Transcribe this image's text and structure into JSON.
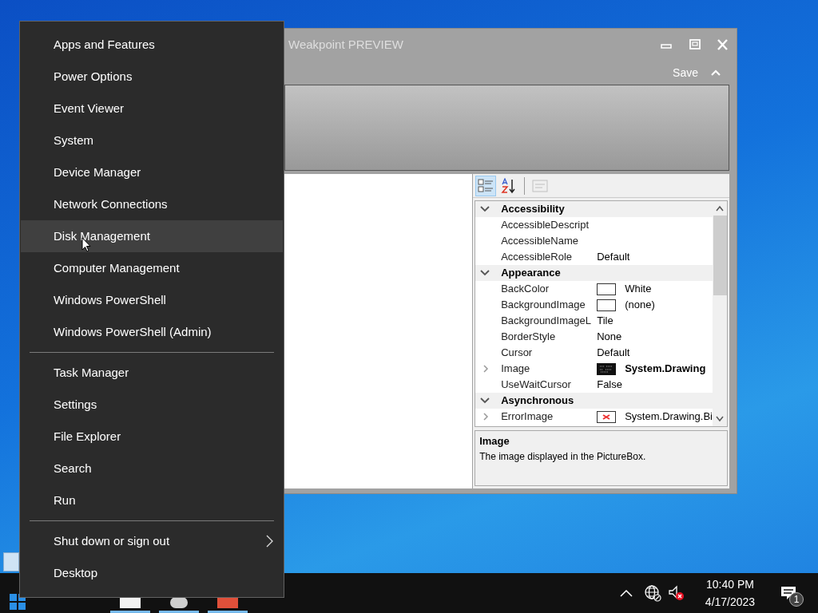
{
  "app_window": {
    "title": "Weakpoint PREVIEW",
    "save_label": "Save",
    "property_grid": {
      "toolbar": [
        {
          "kind": "categorized",
          "selected": true,
          "disabled": false
        },
        {
          "kind": "alphabetical",
          "selected": false,
          "disabled": false
        },
        {
          "kind": "pages",
          "selected": false,
          "disabled": true
        }
      ],
      "rows": [
        {
          "kind": "category",
          "label": "Accessibility",
          "expanded": true
        },
        {
          "kind": "property",
          "name": "AccessibleDescript",
          "expandable": false
        },
        {
          "kind": "property",
          "name": "AccessibleName",
          "expandable": false
        },
        {
          "kind": "property",
          "name": "AccessibleRole",
          "value": "Default",
          "expandable": false,
          "bold": false
        },
        {
          "kind": "category",
          "label": "Appearance",
          "expanded": true
        },
        {
          "kind": "property",
          "name": "BackColor",
          "value": "White",
          "swatch": {
            "kind": "white"
          },
          "expandable": false,
          "bold": false
        },
        {
          "kind": "property",
          "name": "BackgroundImage",
          "value": "(none)",
          "swatch": {
            "kind": "blank"
          },
          "expandable": false,
          "bold": false
        },
        {
          "kind": "property",
          "name": "BackgroundImageL",
          "value": "Tile",
          "expandable": false,
          "bold": false
        },
        {
          "kind": "property",
          "name": "BorderStyle",
          "value": "None",
          "expandable": false,
          "bold": false
        },
        {
          "kind": "property",
          "name": "Cursor",
          "value": "Default",
          "expandable": false,
          "bold": false
        },
        {
          "kind": "property",
          "name": "Image",
          "value": "System.Drawing",
          "swatch": {
            "kind": "image"
          },
          "expandable": true,
          "bold": true
        },
        {
          "kind": "property",
          "name": "UseWaitCursor",
          "value": "False",
          "expandable": false,
          "bold": false
        },
        {
          "kind": "category",
          "label": "Asynchronous",
          "expanded": true
        },
        {
          "kind": "property",
          "name": "ErrorImage",
          "value": "System.Drawing.Bi",
          "swatch": {
            "kind": "error"
          },
          "expandable": true,
          "bold": false
        }
      ],
      "description": {
        "title": "Image",
        "text": "The image displayed in the PictureBox."
      }
    }
  },
  "context_menu": {
    "groups": [
      [
        {
          "label": "Apps and Features",
          "selected": false,
          "has_submenu": false
        },
        {
          "label": "Power Options",
          "selected": false,
          "has_submenu": false
        },
        {
          "label": "Event Viewer",
          "selected": false,
          "has_submenu": false
        },
        {
          "label": "System",
          "selected": false,
          "has_submenu": false
        },
        {
          "label": "Device Manager",
          "selected": false,
          "has_submenu": false
        },
        {
          "label": "Network Connections",
          "selected": false,
          "has_submenu": false
        },
        {
          "label": "Disk Management",
          "selected": true,
          "has_submenu": false
        },
        {
          "label": "Computer Management",
          "selected": false,
          "has_submenu": false
        },
        {
          "label": "Windows PowerShell",
          "selected": false,
          "has_submenu": false
        },
        {
          "label": "Windows PowerShell (Admin)",
          "selected": false,
          "has_submenu": false
        }
      ],
      [
        {
          "label": "Task Manager",
          "selected": false,
          "has_submenu": false
        },
        {
          "label": "Settings",
          "selected": false,
          "has_submenu": false
        },
        {
          "label": "File Explorer",
          "selected": false,
          "has_submenu": false
        },
        {
          "label": "Search",
          "selected": false,
          "has_submenu": false
        },
        {
          "label": "Run",
          "selected": false,
          "has_submenu": false
        }
      ],
      [
        {
          "label": "Shut down or sign out",
          "selected": false,
          "has_submenu": true
        },
        {
          "label": "Desktop",
          "selected": false,
          "has_submenu": false
        }
      ]
    ]
  },
  "taskbar": {
    "time": "10:40 PM",
    "date": "4/17/2023",
    "notification_count": "1"
  }
}
